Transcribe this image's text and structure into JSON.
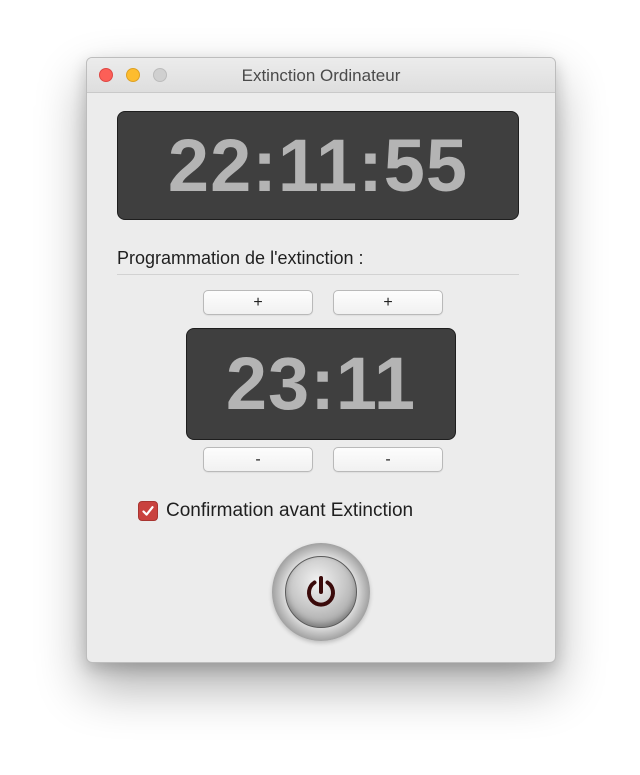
{
  "window": {
    "title": "Extinction Ordinateur",
    "controls": [
      "close",
      "minimize",
      "zoom"
    ]
  },
  "current_time": "22:11:55",
  "schedule": {
    "section_label": "Programmation de l'extinction :",
    "hour_increment_label": "+",
    "minute_increment_label": "+",
    "shutdown_time": "23:11",
    "hour_decrement_label": "-",
    "minute_decrement_label": "-"
  },
  "confirmation": {
    "label": "Confirmation avant Extinction",
    "checked": true
  },
  "power_button": {
    "icon": "power-icon"
  },
  "colors": {
    "display_background": "#3f3f3f",
    "display_digits": "#b4b4b4",
    "checkbox_accent": "#c9423e",
    "power_symbol": "#3a0a0a"
  }
}
